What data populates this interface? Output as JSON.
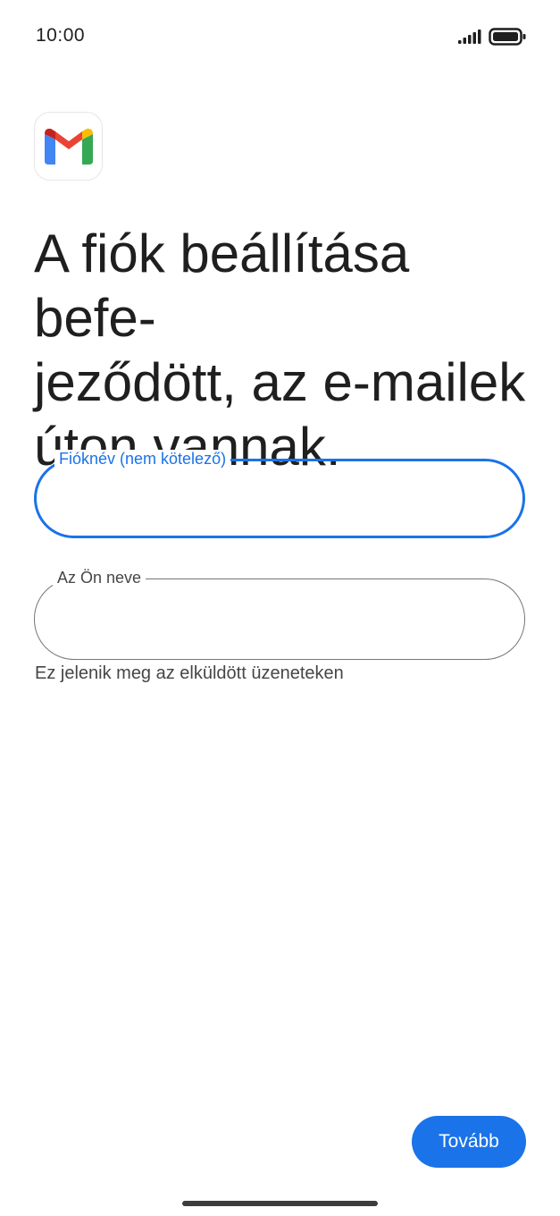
{
  "status_bar": {
    "time": "10:00",
    "signal_icon": "signal-icon",
    "battery_icon": "battery-icon"
  },
  "app": {
    "logo_icon": "gmail-logo-icon",
    "brand_colors": {
      "blue": "#4285F4",
      "red": "#EA4335",
      "yellow": "#FBBC04",
      "green": "#34A853",
      "dark_red": "#C5221F"
    }
  },
  "page": {
    "title": "A fiók beállítása befe-\njeződött, az e-mailek\núton vannak."
  },
  "form": {
    "account_name": {
      "label": "Fióknév (nem kötelező)",
      "value": ""
    },
    "your_name": {
      "label": "Az Ön neve",
      "value": "",
      "helper": "Ez jelenik meg az elküldött üzeneteken"
    }
  },
  "actions": {
    "next_label": "Tovább",
    "accent_color": "#1A73E8"
  }
}
